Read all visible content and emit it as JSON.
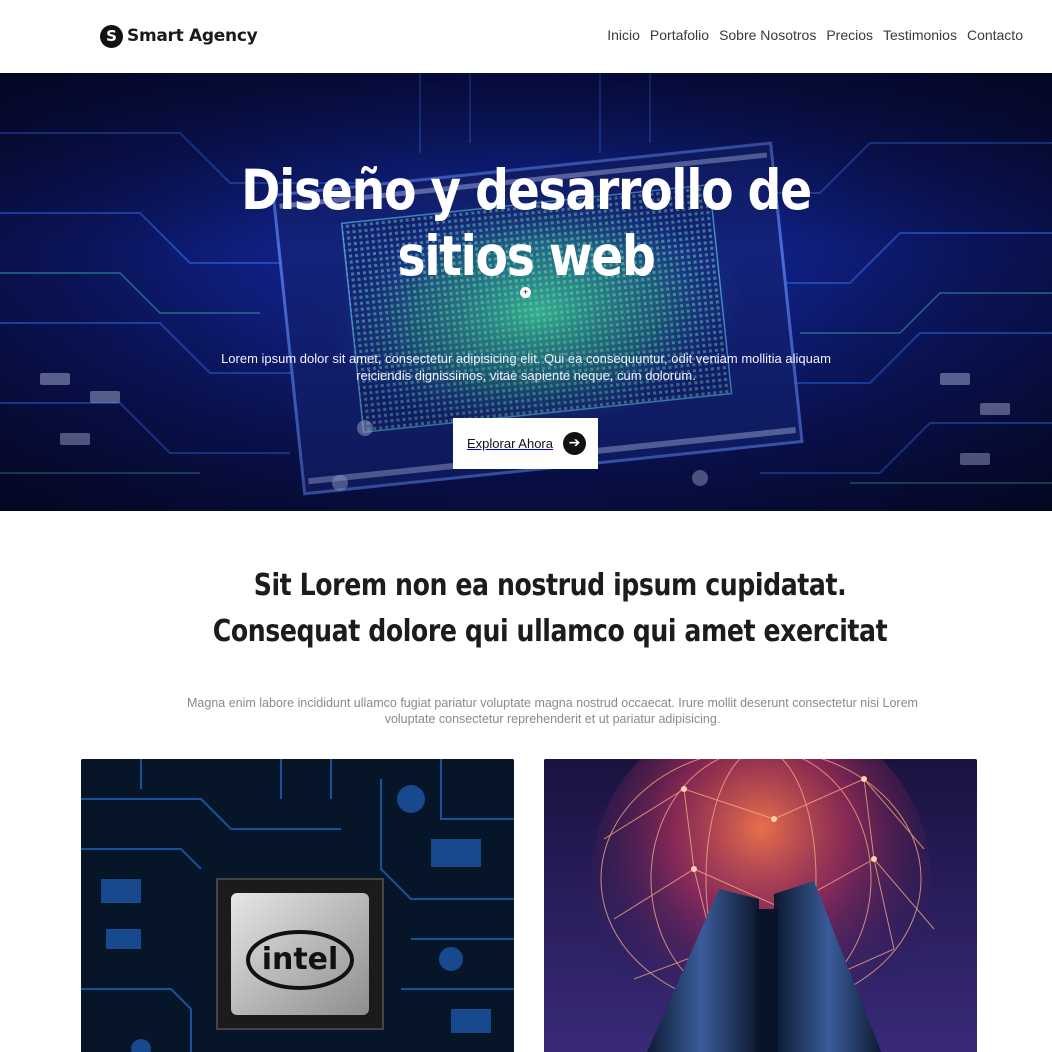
{
  "header": {
    "logo_mark": "S",
    "logo_text": "Smart Agency",
    "nav": [
      "Inicio",
      "Portafolio",
      "Sobre Nosotros",
      "Precios",
      "Testimonios",
      "Contacto"
    ]
  },
  "hero": {
    "title": "Diseño y desarrollo de sitios web",
    "subtitle": "Lorem ipsum dolor sit amet, consectetur adipisicing elit. Qui ea consequuntur, odit veniam mollitia aliquam reiciendis dignissimos, vitae sapiente neque, cum dolorum.",
    "button_label": "Explorar Ahora",
    "button_icon": "arrow-right-icon",
    "button_icon_glyph": "➔",
    "background": "circuit-board-image"
  },
  "intro": {
    "title": "Sit Lorem non ea nostrud ipsum cupidatat. Consequat dolore qui ullamco qui amet exercitat",
    "text": "Magna enim labore incididunt ullamco fugiat pariatur voluptate magna nostrud occaecat. Irure mollit deserunt consectetur nisi Lorem voluptate consectetur reprehenderit et ut pariatur adipisicing."
  },
  "cards": [
    {
      "image": "intel-chip-motherboard-image",
      "chip_label": "intel"
    },
    {
      "image": "network-globe-server-image"
    }
  ],
  "colors": {
    "hero_blue": "#10228a",
    "text_dark": "#1c1c1c",
    "text_muted": "#8a8a8a",
    "button_bg": "#ffffff"
  }
}
